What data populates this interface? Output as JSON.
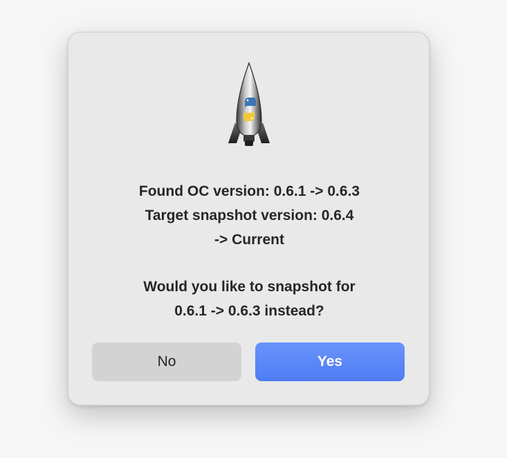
{
  "dialog": {
    "icon": "python-rocket-icon",
    "message_lines": [
      "Found OC version: 0.6.1 -> 0.6.3",
      "Target snapshot version: 0.6.4",
      "-> Current"
    ],
    "question_lines": [
      "Would you like to snapshot for",
      "0.6.1 -> 0.6.3 instead?"
    ],
    "buttons": {
      "no_label": "No",
      "yes_label": "Yes"
    }
  },
  "colors": {
    "accent": "#5a84f7",
    "dialog_bg": "#e9e9e9",
    "secondary_button": "#d3d3d3"
  }
}
